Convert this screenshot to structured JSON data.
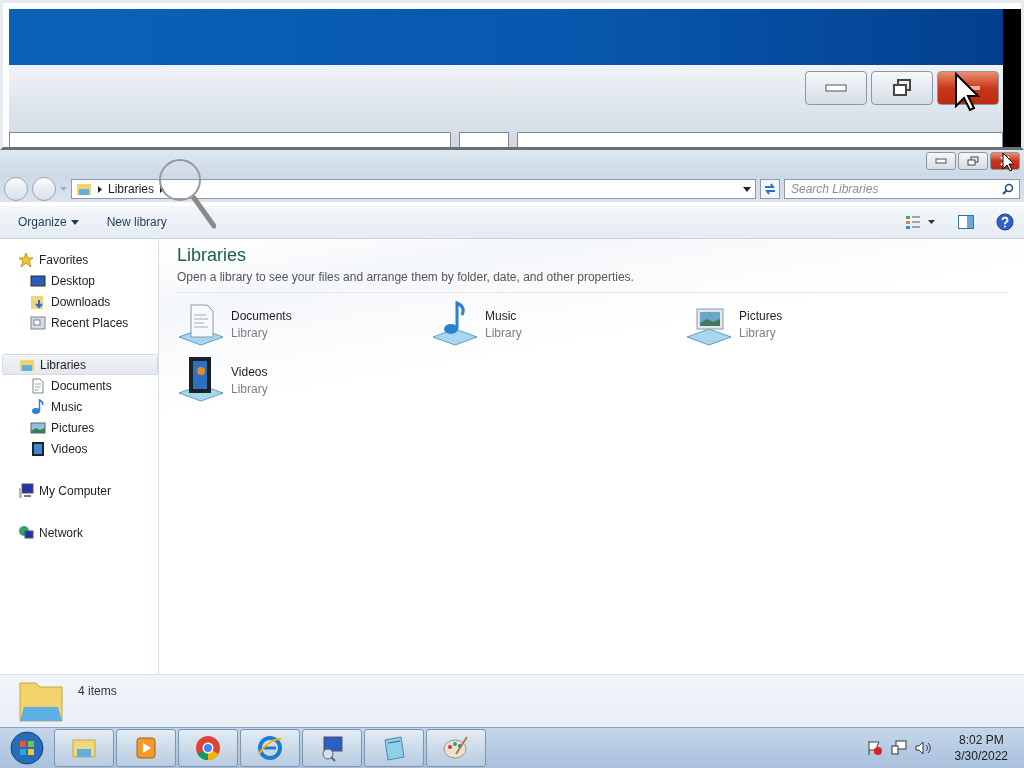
{
  "address_bar": {
    "breadcrumb": [
      "Libraries"
    ],
    "search": {
      "placeholder": "Search Libraries"
    }
  },
  "toolbar": {
    "buttons": [
      {
        "label": "Organize",
        "kind": "menu"
      },
      {
        "label": "New library",
        "kind": "plain"
      }
    ]
  },
  "sidebar": {
    "groups": [
      {
        "label": "Favorites",
        "kind": "star",
        "selected": false,
        "children": [
          {
            "label": "Desktop",
            "kind": "desktop",
            "selected": false
          },
          {
            "label": "Downloads",
            "kind": "downloads",
            "selected": false
          },
          {
            "label": "Recent Places",
            "kind": "recent",
            "selected": false
          }
        ]
      },
      {
        "label": "Libraries",
        "kind": "library",
        "selected": true,
        "children": [
          {
            "label": "Documents",
            "kind": "documents",
            "selected": false
          },
          {
            "label": "Music",
            "kind": "music",
            "selected": false
          },
          {
            "label": "Pictures",
            "kind": "pictures",
            "selected": false
          },
          {
            "label": "Videos",
            "kind": "videos",
            "selected": false
          }
        ]
      },
      {
        "label": "My Computer",
        "kind": "computer",
        "selected": false
      },
      {
        "label": "Network",
        "kind": "network",
        "selected": false
      }
    ]
  },
  "content": {
    "title": "Libraries",
    "description": "Open a library to see your files and arrange them by folder, date, and other properties.",
    "libraries": [
      {
        "name": "Documents",
        "type": "Library",
        "kind": "documents"
      },
      {
        "name": "Music",
        "type": "Library",
        "kind": "music"
      },
      {
        "name": "Pictures",
        "type": "Library",
        "kind": "pictures"
      },
      {
        "name": "Videos",
        "type": "Library",
        "kind": "videos"
      }
    ]
  },
  "details_pane": {
    "count": "4 items"
  },
  "taskbar": {
    "apps": [
      {
        "kind": "explorer"
      },
      {
        "kind": "media"
      },
      {
        "kind": "chrome"
      },
      {
        "kind": "ie"
      },
      {
        "kind": "remote"
      },
      {
        "kind": "notepad"
      },
      {
        "kind": "paint"
      }
    ],
    "clock": {
      "time": "8:02 PM",
      "date": "3/30/2022"
    }
  }
}
